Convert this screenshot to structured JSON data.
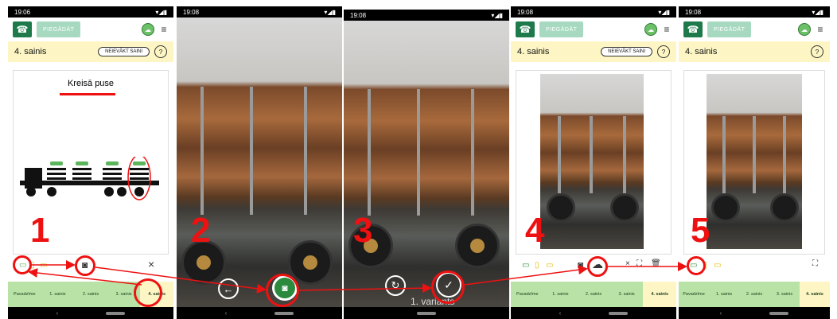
{
  "phones": [
    {
      "time": "19:06",
      "deliver": "PIEGĀDĀT",
      "title": "4. sainis",
      "show_bundle": "NEIEVĀKT SAINI",
      "side_label": "Kreisā puse"
    },
    {
      "time": "19:08"
    },
    {
      "time": "19:08",
      "variant": "1. variants"
    },
    {
      "time": "19:08",
      "deliver": "PIEGĀDĀT",
      "title": "4. sainis",
      "show_bundle": "NEIEVĀKT SAINI"
    },
    {
      "time": "19:08",
      "deliver": "PIEGĀDĀT",
      "title": "4. sainis"
    }
  ],
  "tabs": [
    "Pavadzīme",
    "1. sainis",
    "2. sainis",
    "3. sainis",
    "4. sainis"
  ],
  "steps": [
    "1",
    "2",
    "3",
    "4",
    "5"
  ],
  "icons": {
    "signal": "▾◢▮",
    "menu": "≡",
    "help": "?",
    "close": "×",
    "back": "‹",
    "camera": "camera-icon",
    "check": "✓",
    "retake": "↻",
    "arrow": "←",
    "expand": "⛶",
    "cloud": "☁"
  },
  "colors": {
    "accent": "#1e7a4a",
    "highlight": "#e11111",
    "tab_bg": "#b9e3a6",
    "title_bg": "#fdf6c4"
  }
}
